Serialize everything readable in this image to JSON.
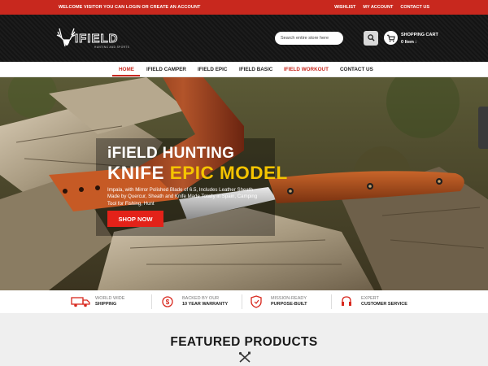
{
  "topbar": {
    "welcome": "WELCOME VISITOR YOU CAN LOGIN OR CREATE AN ACCOUNT",
    "links": [
      "WISHLIST",
      "MY ACCOUNT",
      "CONTACT US"
    ]
  },
  "header": {
    "logo_text": "IFIELD",
    "logo_tagline": "HUNTING AND SPORTS",
    "search_placeholder": "Search entire store here",
    "search_icon": "search-icon",
    "cart_icon": "shopping-cart-icon",
    "cart_title": "SHOPPING CART",
    "cart_count": "0 Item :"
  },
  "nav": {
    "items": [
      {
        "label": "HOME",
        "active": true
      },
      {
        "label": "IFIELD CAMPER",
        "active": false
      },
      {
        "label": "IFIELD EPIC",
        "active": false
      },
      {
        "label": "IFIELD BASIC",
        "active": false
      },
      {
        "label": "IFIELD WORKOUT",
        "active": false,
        "highlight": true
      },
      {
        "label": "CONTACT US",
        "active": false
      }
    ]
  },
  "hero": {
    "title_prefix": "iFIELD",
    "title_accent": "HUNTING",
    "subtitle_prefix": "KNIFE",
    "subtitle_accent": "EPIC MODEL",
    "description": "Impala, with Mirror Polished Blade of 6.5, Includes Leather Sheath Made by Quercur, Sheath and Knife Made Totally in Spain, Camping Tool for Fishing, Hunt",
    "cta": "SHOP NOW"
  },
  "features": [
    {
      "icon": "truck-icon",
      "line1": "WORLD WIDE",
      "line2": "SHIPPING"
    },
    {
      "icon": "dollar-icon",
      "line1": "BACKED BY OUR",
      "line2": "10 YEAR WARRANTY"
    },
    {
      "icon": "shield-icon",
      "line1": "MISSION-READY",
      "line2": "PURPOSE-BUILT"
    },
    {
      "icon": "support-icon",
      "line1": "EXPERT",
      "line2": "CUSTOMER SERVICE"
    }
  ],
  "featured": {
    "title": "FEATURED PRODUCTS",
    "icon": "crossed-tools-icon"
  },
  "colors": {
    "brand_red": "#c8281e",
    "accent_yellow": "#f5c400",
    "header_dark": "#161616"
  }
}
